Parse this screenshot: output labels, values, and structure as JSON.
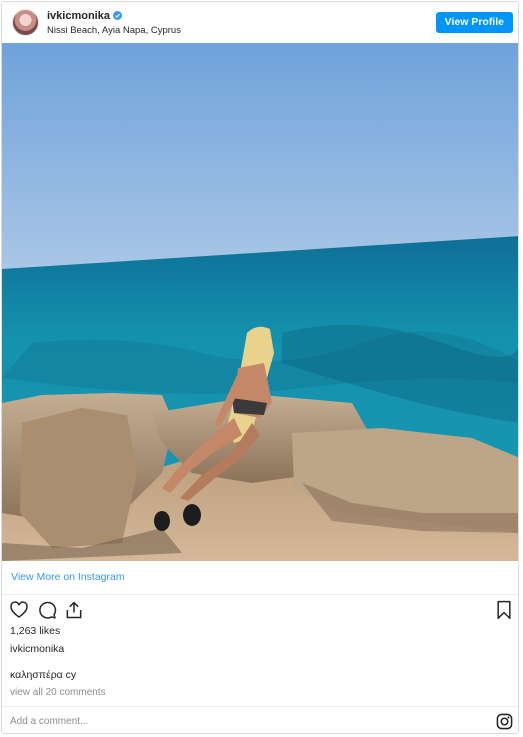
{
  "header": {
    "username": "ivkicmonika",
    "location": "Nissi Beach, Ayia Napa, Cyprus",
    "view_profile": "View Profile"
  },
  "photo": {
    "description_icon": "beach-photo"
  },
  "links": {
    "view_more": "View More on Instagram"
  },
  "actions": {
    "icons": [
      "heart-icon",
      "comment-icon",
      "share-icon",
      "bookmark-icon"
    ]
  },
  "post": {
    "likes": "1,263 likes",
    "owner": "ivkicmonika",
    "caption": "καλησπέρα cy",
    "comments_link": "view all 20 comments"
  },
  "comment_bar": {
    "placeholder": "Add a comment...",
    "icon": "instagram-icon"
  },
  "colors": {
    "accent": "#0095f6",
    "link": "#3897f0",
    "muted": "#8e8e8e"
  }
}
